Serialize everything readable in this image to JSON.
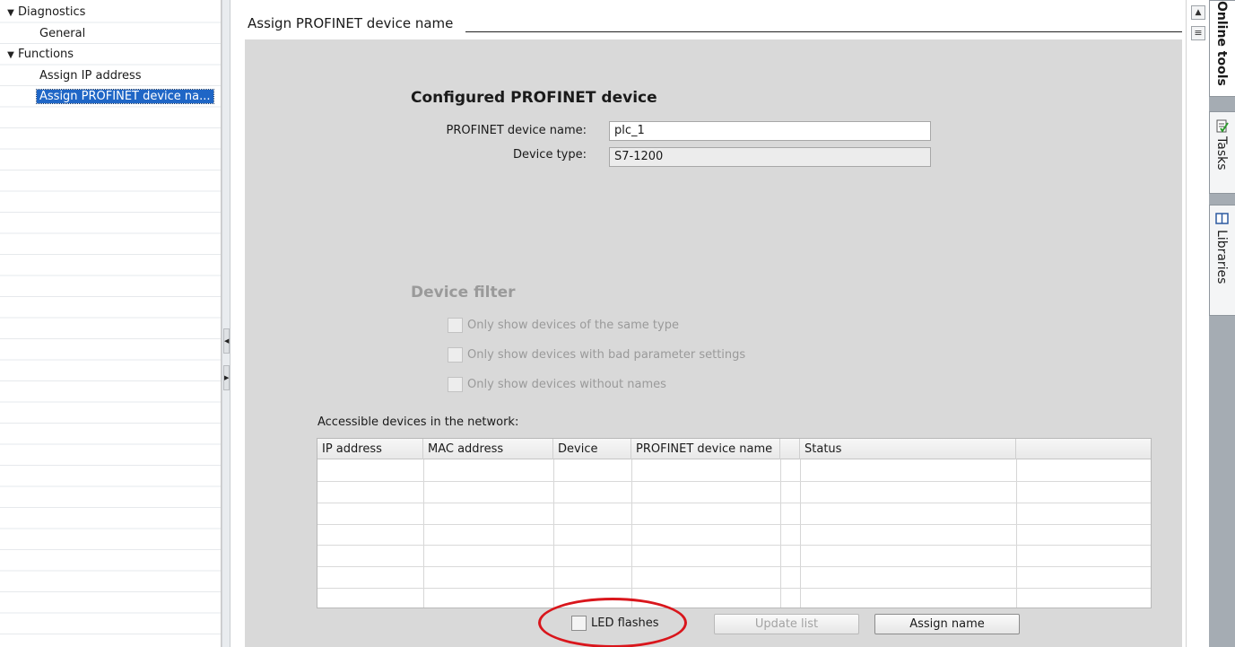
{
  "nav_tree": {
    "items": [
      {
        "label": "Diagnostics",
        "level": 0,
        "expanded": true
      },
      {
        "label": "General",
        "level": 1
      },
      {
        "label": "Functions",
        "level": 0,
        "expanded": true
      },
      {
        "label": "Assign IP address",
        "level": 1
      },
      {
        "label": "Assign PROFINET device na...",
        "level": 1,
        "selected": true
      }
    ]
  },
  "main": {
    "section_title": "Assign PROFINET device name",
    "configured": {
      "heading": "Configured PROFINET device",
      "device_name_label": "PROFINET device name:",
      "device_name_value": "plc_1",
      "device_type_label": "Device type:",
      "device_type_value": "S7-1200"
    },
    "filter": {
      "heading": "Device filter",
      "options": [
        "Only show devices of the same type",
        "Only show devices with bad parameter settings",
        "Only show devices without names"
      ]
    },
    "table": {
      "caption": "Accessible devices in the network:",
      "columns": [
        "IP address",
        "MAC address",
        "Device",
        "PROFINET device name",
        "",
        "Status",
        ""
      ],
      "rows": []
    },
    "led_label": "LED flashes",
    "update_button": "Update list",
    "assign_button": "Assign name"
  },
  "taskcards": {
    "tabs": [
      "Online tools",
      "Tasks",
      "Libraries"
    ]
  },
  "colors": {
    "selection": "#1f66c6",
    "panel": "#d9d9d9",
    "highlight_ellipse": "#d9161c"
  }
}
